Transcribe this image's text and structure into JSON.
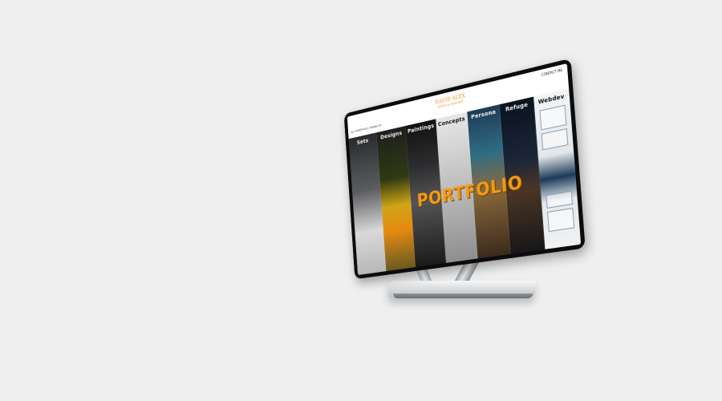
{
  "site": {
    "brand": "DAVID ALEX",
    "brand_sub": "ARTIST & DESIGNER",
    "nav_left": "ALL PORTFOLIO | PROJECTS",
    "nav_right": "CONTACT ME"
  },
  "categories": [
    {
      "label": "Sets"
    },
    {
      "label": "Designs"
    },
    {
      "label": "Paintings"
    },
    {
      "label": "Concepts"
    },
    {
      "label": "Persona"
    },
    {
      "label": "Refuge"
    },
    {
      "label": "Webdev"
    }
  ],
  "hero": {
    "title": "PORTFOLIO"
  },
  "colors": {
    "background": "#efefef",
    "accent": "#f39a12",
    "bezel": "#0c0c0e"
  }
}
